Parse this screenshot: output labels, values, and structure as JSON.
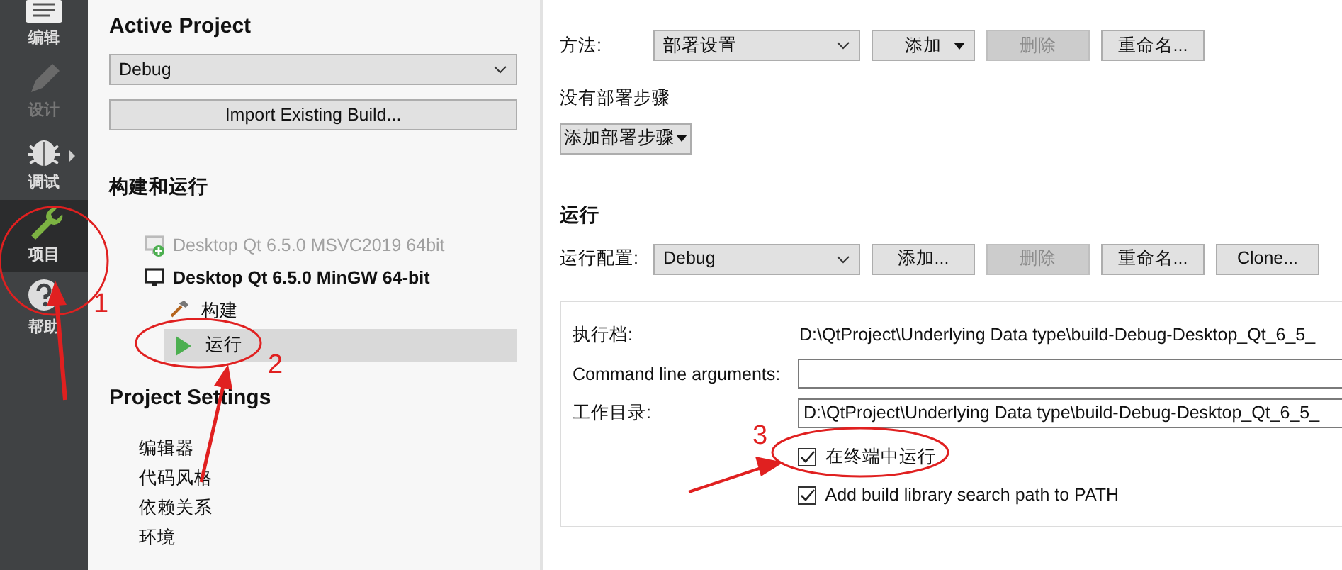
{
  "sidebar": {
    "items": [
      {
        "label": "编辑",
        "kind": "edit",
        "selected": false,
        "disabled": false,
        "submenu": false
      },
      {
        "label": "设计",
        "kind": "design",
        "selected": false,
        "disabled": true,
        "submenu": false
      },
      {
        "label": "调试",
        "kind": "debug",
        "selected": false,
        "disabled": false,
        "submenu": true
      },
      {
        "label": "项目",
        "kind": "projects",
        "selected": true,
        "disabled": false,
        "submenu": false
      },
      {
        "label": "帮助",
        "kind": "help",
        "selected": false,
        "disabled": false,
        "submenu": false
      }
    ]
  },
  "active_project": {
    "title": "Active Project",
    "select": "Debug",
    "import_button": "Import Existing Build..."
  },
  "build_run": {
    "title": "构建和运行",
    "kits": [
      {
        "name": "Desktop Qt 6.5.0 MSVC2019 64bit",
        "enabled": false
      },
      {
        "name": "Desktop Qt 6.5.0 MinGW 64-bit",
        "enabled": true,
        "children": [
          {
            "label": "构建",
            "kind": "build",
            "selected": false
          },
          {
            "label": "运行",
            "kind": "run",
            "selected": true
          }
        ]
      }
    ]
  },
  "project_settings": {
    "title": "Project Settings",
    "items": [
      "编辑器",
      "代码风格",
      "依赖关系",
      "环境"
    ]
  },
  "deploy": {
    "method_label": "方法:",
    "method": "部署设置",
    "buttons": [
      {
        "label": "添加",
        "dropdown": true,
        "disabled": false
      },
      {
        "label": "删除",
        "dropdown": false,
        "disabled": true
      },
      {
        "label": "重命名...",
        "dropdown": false,
        "disabled": false
      }
    ],
    "empty_text": "没有部署步骤",
    "add_step": {
      "label": "添加部署步骤",
      "dropdown": true
    }
  },
  "run": {
    "title": "运行",
    "config_label": "运行配置:",
    "config": "Debug",
    "buttons": [
      {
        "label": "添加...",
        "dropdown": false,
        "disabled": false
      },
      {
        "label": "删除",
        "dropdown": false,
        "disabled": true
      },
      {
        "label": "重命名...",
        "dropdown": false,
        "disabled": false
      },
      {
        "label": "Clone...",
        "dropdown": false,
        "disabled": false
      }
    ],
    "fields": [
      {
        "label": "执行档:",
        "kind": "text",
        "value": "D:\\QtProject\\Underlying Data type\\build-Debug-Desktop_Qt_6_5_"
      },
      {
        "label": "Command line arguments:",
        "kind": "input"
      },
      {
        "label": "工作目录:",
        "kind": "input",
        "value": "D:\\QtProject\\Underlying Data type\\build-Debug-Desktop_Qt_6_5_"
      }
    ],
    "checks": [
      {
        "label": "在终端中运行",
        "checked": true
      },
      {
        "label": "Add build library search path to PATH",
        "checked": true
      }
    ]
  },
  "annotations": [
    {
      "label": "1"
    },
    {
      "label": "2"
    },
    {
      "label": "3"
    }
  ]
}
